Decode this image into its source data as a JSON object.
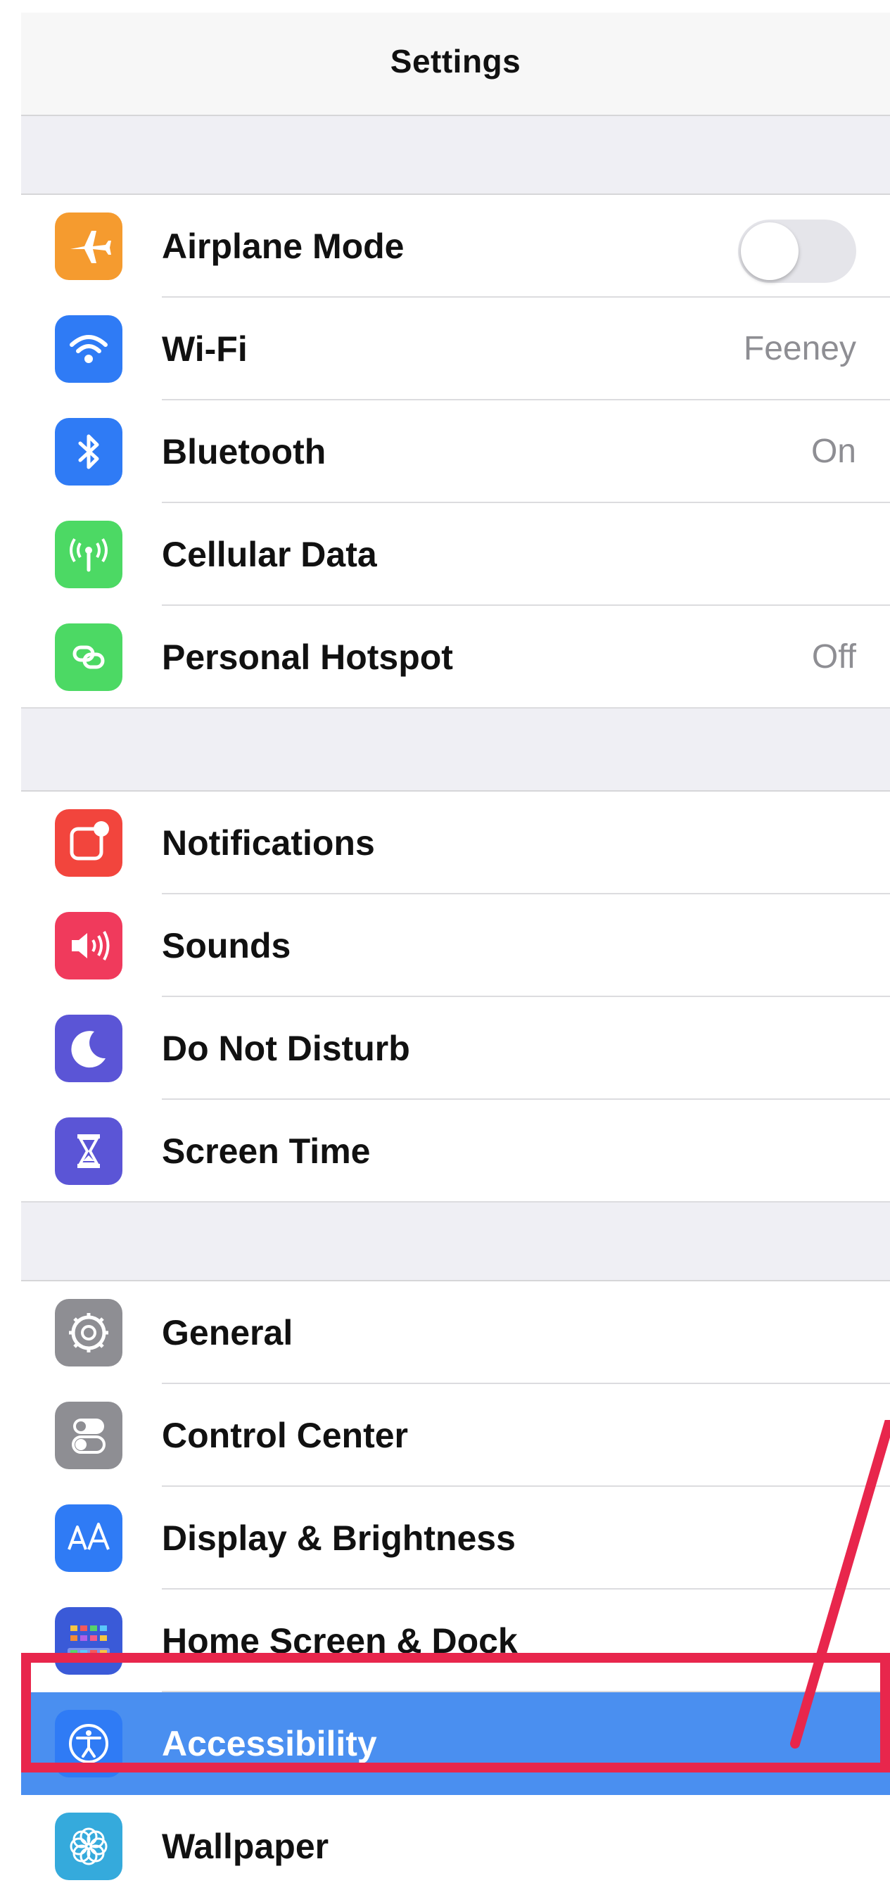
{
  "navbar": {
    "title": "Settings"
  },
  "rows": [
    {
      "label": "Airplane Mode",
      "value": "",
      "toggle": true,
      "toggle_on": false,
      "icon": "airplane-icon",
      "color": "#f59b2f"
    },
    {
      "label": "Wi-Fi",
      "value": "Feeney",
      "icon": "wifi-icon",
      "color": "#2f7bf5"
    },
    {
      "label": "Bluetooth",
      "value": "On",
      "icon": "bluetooth-icon",
      "color": "#2f7bf5"
    },
    {
      "label": "Cellular Data",
      "value": "",
      "icon": "antenna-icon",
      "color": "#4cd964"
    },
    {
      "label": "Personal Hotspot",
      "value": "Off",
      "icon": "hotspot-icon",
      "color": "#4cd964"
    },
    {
      "label": "Notifications",
      "value": "",
      "icon": "notifications-icon",
      "color": "#f2453d"
    },
    {
      "label": "Sounds",
      "value": "",
      "icon": "speaker-icon",
      "color": "#f03a5c"
    },
    {
      "label": "Do Not Disturb",
      "value": "",
      "icon": "moon-icon",
      "color": "#5b55d6"
    },
    {
      "label": "Screen Time",
      "value": "",
      "icon": "hourglass-icon",
      "color": "#5b55d6"
    },
    {
      "label": "General",
      "value": "",
      "icon": "gear-icon",
      "color": "#8e8e93"
    },
    {
      "label": "Control Center",
      "value": "",
      "icon": "toggles-icon",
      "color": "#8e8e93"
    },
    {
      "label": "Display & Brightness",
      "value": "",
      "icon": "text-size-icon",
      "color": "#2f7bf5"
    },
    {
      "label": "Home Screen & Dock",
      "value": "",
      "icon": "app-grid-icon",
      "color": "#3a5ad8"
    },
    {
      "label": "Accessibility",
      "value": "",
      "icon": "accessibility-icon",
      "color": "#2f7bf5",
      "selected": true
    },
    {
      "label": "Wallpaper",
      "value": "",
      "icon": "flower-icon",
      "color": "#35aadc"
    }
  ],
  "annotation": {
    "highlight_color": "#e8264c",
    "highlighted_row": "Accessibility"
  }
}
